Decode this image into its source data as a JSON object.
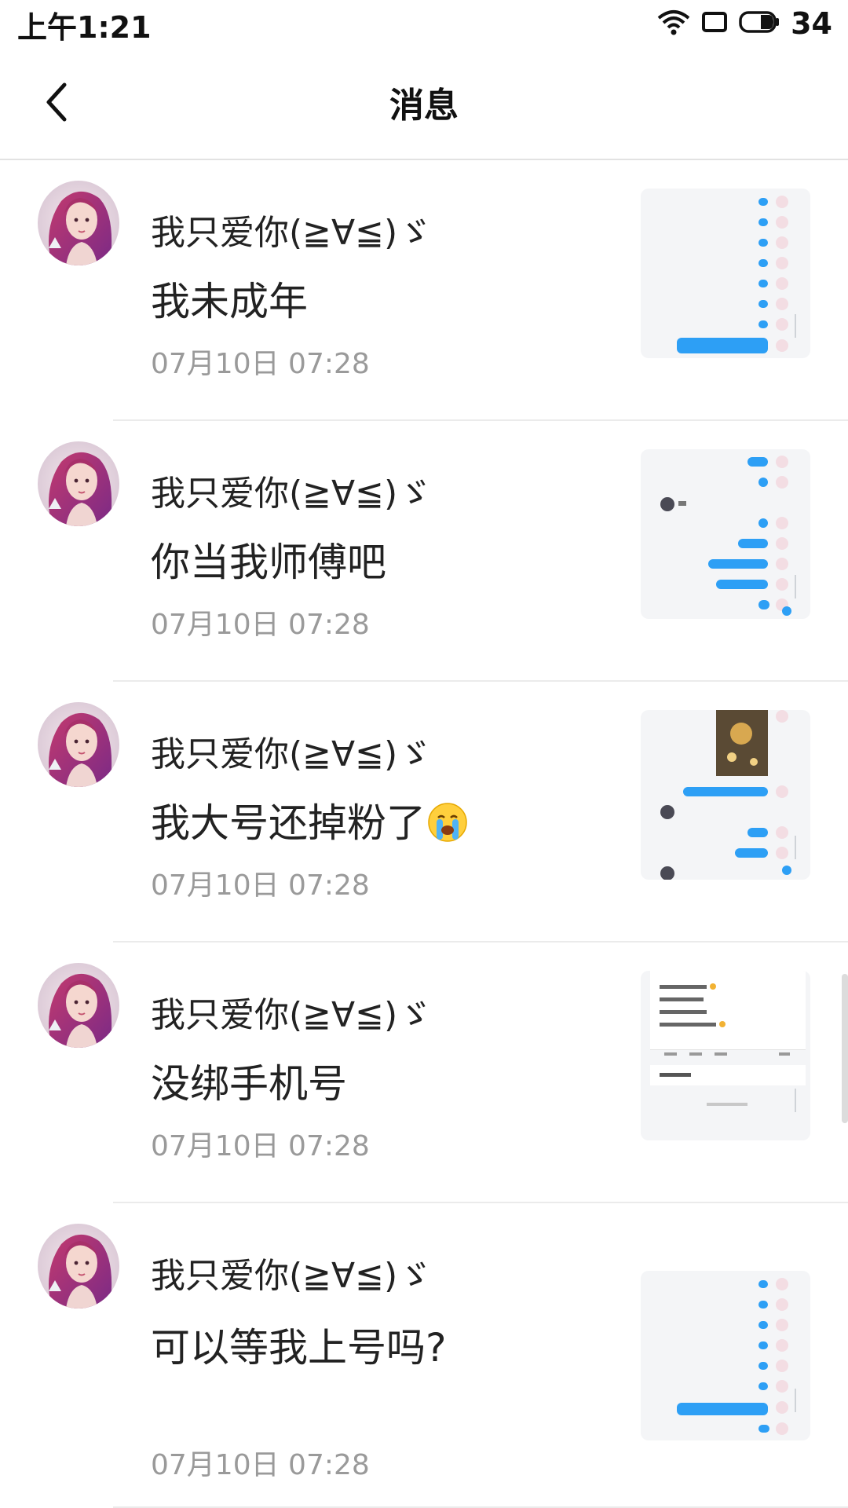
{
  "status_bar": {
    "time": "上午1:21",
    "battery": "34"
  },
  "header": {
    "title": "消息"
  },
  "messages": [
    {
      "sender": "我只爱你(≧∀≦)ゞ",
      "text": "我未成年",
      "time": "07月10日 07:28"
    },
    {
      "sender": "我只爱你(≧∀≦)ゞ",
      "text": "你当我师傅吧",
      "time": "07月10日 07:28"
    },
    {
      "sender": "我只爱你(≧∀≦)ゞ",
      "text": "我大号还掉粉了",
      "time": "07月10日 07:28",
      "emoji": "crying-face"
    },
    {
      "sender": "我只爱你(≧∀≦)ゞ",
      "text": "没绑手机号",
      "time": "07月10日 07:28"
    },
    {
      "sender": "我只爱你(≧∀≦)ゞ",
      "text": "可以等我上号吗?",
      "time": "07月10日 07:28"
    }
  ],
  "colors": {
    "accent_blue": "#2d9ff5",
    "timestamp_gray": "#9a9a9a"
  }
}
